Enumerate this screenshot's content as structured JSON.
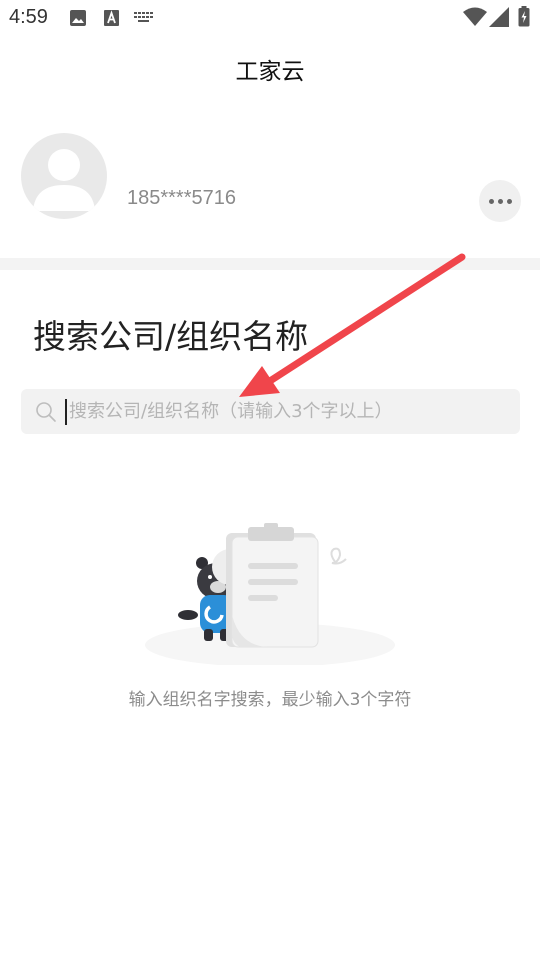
{
  "status_bar": {
    "time": "4:59",
    "left_icons": [
      "image-icon",
      "text-a-icon",
      "keyboard-icon"
    ],
    "right_icons": [
      "wifi-icon",
      "signal-icon",
      "battery-icon"
    ]
  },
  "header": {
    "title": "工家云"
  },
  "profile": {
    "phone": "185****5716",
    "more_icon": "more-dots-icon"
  },
  "search": {
    "title": "搜索公司/组织名称",
    "placeholder": "搜索公司/组织名称（请输入3个字以上）",
    "value": ""
  },
  "empty_state": {
    "hint": "输入组织名字搜索，最少输入3个字符",
    "illustration": "bear-with-clipboard"
  },
  "colors": {
    "arrow": "#f0454b",
    "badge_blue": "#2b8fd8",
    "divider": "#f3f3f3"
  }
}
